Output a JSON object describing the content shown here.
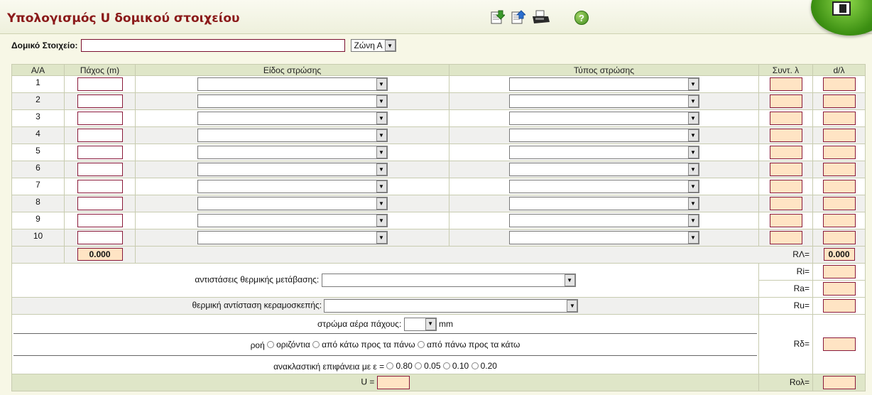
{
  "page": {
    "title": "Υπολογισμός U δομικού στοιχείου",
    "help": "?"
  },
  "element": {
    "label": "Δομικό Στοιχείο:",
    "value": "",
    "zone": "Ζώνη Α"
  },
  "table": {
    "headers": {
      "aa": "Α/Α",
      "thickness": "Πάχος (m)",
      "layer_kind": "Είδος στρώσης",
      "layer_type": "Τύπος στρώσης",
      "lambda": "Συντ. λ",
      "d_lambda": "d/λ"
    },
    "rows": [
      {
        "n": "1"
      },
      {
        "n": "2"
      },
      {
        "n": "3"
      },
      {
        "n": "4"
      },
      {
        "n": "5"
      },
      {
        "n": "6"
      },
      {
        "n": "7"
      },
      {
        "n": "8"
      },
      {
        "n": "9"
      },
      {
        "n": "10"
      }
    ],
    "total_thickness": "0.000",
    "r_lambda_label": "RΛ=",
    "r_lambda_value": "0.000"
  },
  "resistances": {
    "transfer_label": "αντιστάσεις θερμικής μετάβασης:",
    "ri_label": "Ri=",
    "ra_label": "Ra=",
    "tile_label": "θερμική αντίσταση κεραμοσκεπής:",
    "ru_label": "Ru=",
    "air_label": "στρώμα αέρα πάχους:",
    "air_unit": "mm",
    "flow_label": "ροή",
    "flow_opts": [
      "οριζόντια",
      "από κάτω προς τα πάνω",
      "από πάνω προς τα κάτω"
    ],
    "rdelta_label": "Rδ=",
    "reflect_label": "ανακλαστική επιφάνεια με ε =",
    "reflect_opts": [
      "0.80",
      "0.05",
      "0.10",
      "0.20"
    ],
    "u_label": "U =",
    "rol_label": "Rολ="
  }
}
